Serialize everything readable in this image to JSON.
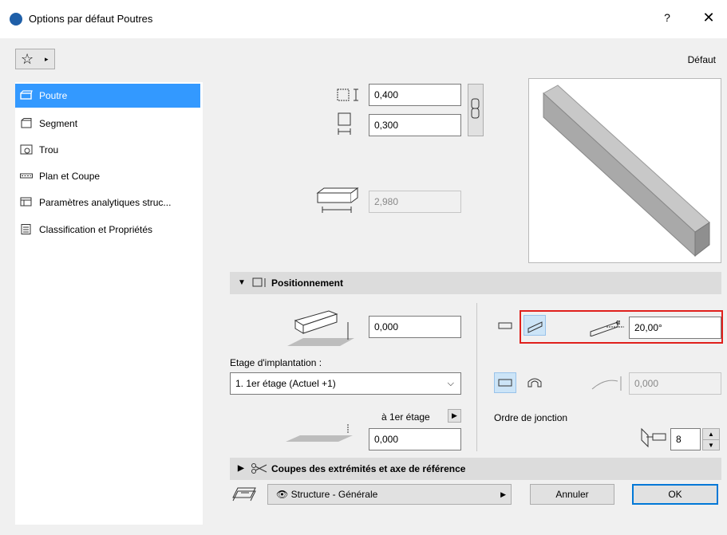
{
  "window": {
    "title": "Options par défaut Poutres",
    "help": "?",
    "close": "✕"
  },
  "toolbar": {
    "favorites_icon": "☆",
    "favorites_arrow": "▸",
    "default_label": "Défaut"
  },
  "sidebar": {
    "items": [
      {
        "label": "Poutre",
        "icon": "beam-icon",
        "selected": true
      },
      {
        "label": "Segment",
        "icon": "segment-icon"
      },
      {
        "label": "Trou",
        "icon": "hole-icon"
      },
      {
        "label": "Plan et Coupe",
        "icon": "floorplan-icon"
      },
      {
        "label": "Paramètres analytiques struc...",
        "icon": "analytic-icon"
      },
      {
        "label": "Classification et Propriétés",
        "icon": "classification-icon"
      }
    ]
  },
  "geometry": {
    "height": "0,400",
    "width": "0,300",
    "length": "2,980"
  },
  "positioning": {
    "title": "Positionnement",
    "elevation": "0,000",
    "story_label": "Etage d'implantation :",
    "story_value": "1. 1er étage (Actuel +1)",
    "to_story_label": "à 1er étage",
    "to_story_value": "0,000",
    "slant_angle": "20,00°",
    "arch_offset": "0,000",
    "junction_label": "Ordre de jonction",
    "junction_value": "8"
  },
  "section2": {
    "title": "Coupes des extrémités et axe de référence"
  },
  "footer": {
    "layer": "Structure - Générale",
    "cancel": "Annuler",
    "ok": "OK"
  },
  "colors": {
    "selection": "#3399ff",
    "highlight": "#e0201c",
    "ok_border": "#0078d7"
  }
}
